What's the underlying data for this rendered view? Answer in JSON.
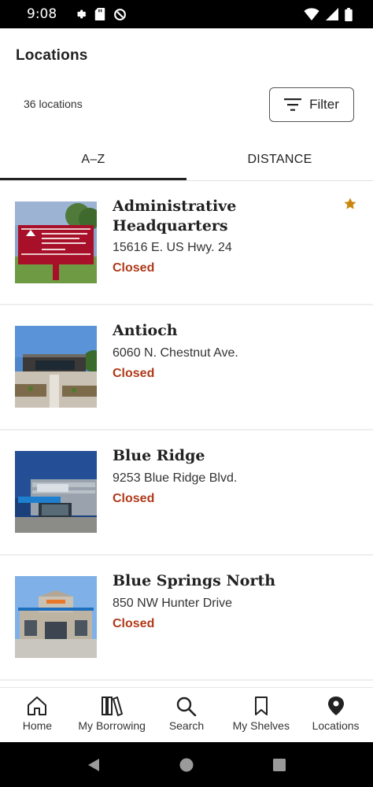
{
  "status_bar": {
    "time": "9:08"
  },
  "header": {
    "title": "Locations"
  },
  "meta": {
    "count_label": "36 locations",
    "filter_label": "Filter"
  },
  "tabs": [
    {
      "label": "A–Z",
      "active": true
    },
    {
      "label": "DISTANCE",
      "active": false
    }
  ],
  "locations": [
    {
      "name": "Administrative Headquarters",
      "address": "15616 E. US Hwy. 24",
      "status": "Closed",
      "favorite": true
    },
    {
      "name": "Antioch",
      "address": "6060 N. Chestnut Ave.",
      "status": "Closed",
      "favorite": false
    },
    {
      "name": "Blue Ridge",
      "address": "9253 Blue Ridge Blvd.",
      "status": "Closed",
      "favorite": false
    },
    {
      "name": "Blue Springs North",
      "address": "850 NW Hunter Drive",
      "status": "Closed",
      "favorite": false
    }
  ],
  "bottom_nav": [
    {
      "label": "Home",
      "icon": "home-icon"
    },
    {
      "label": "My Borrowing",
      "icon": "books-icon"
    },
    {
      "label": "Search",
      "icon": "search-icon"
    },
    {
      "label": "My Shelves",
      "icon": "bookmark-icon"
    },
    {
      "label": "Locations",
      "icon": "map-pin-icon"
    }
  ],
  "colors": {
    "status_closed": "#b03a1a",
    "favorite_star": "#c8860a"
  }
}
